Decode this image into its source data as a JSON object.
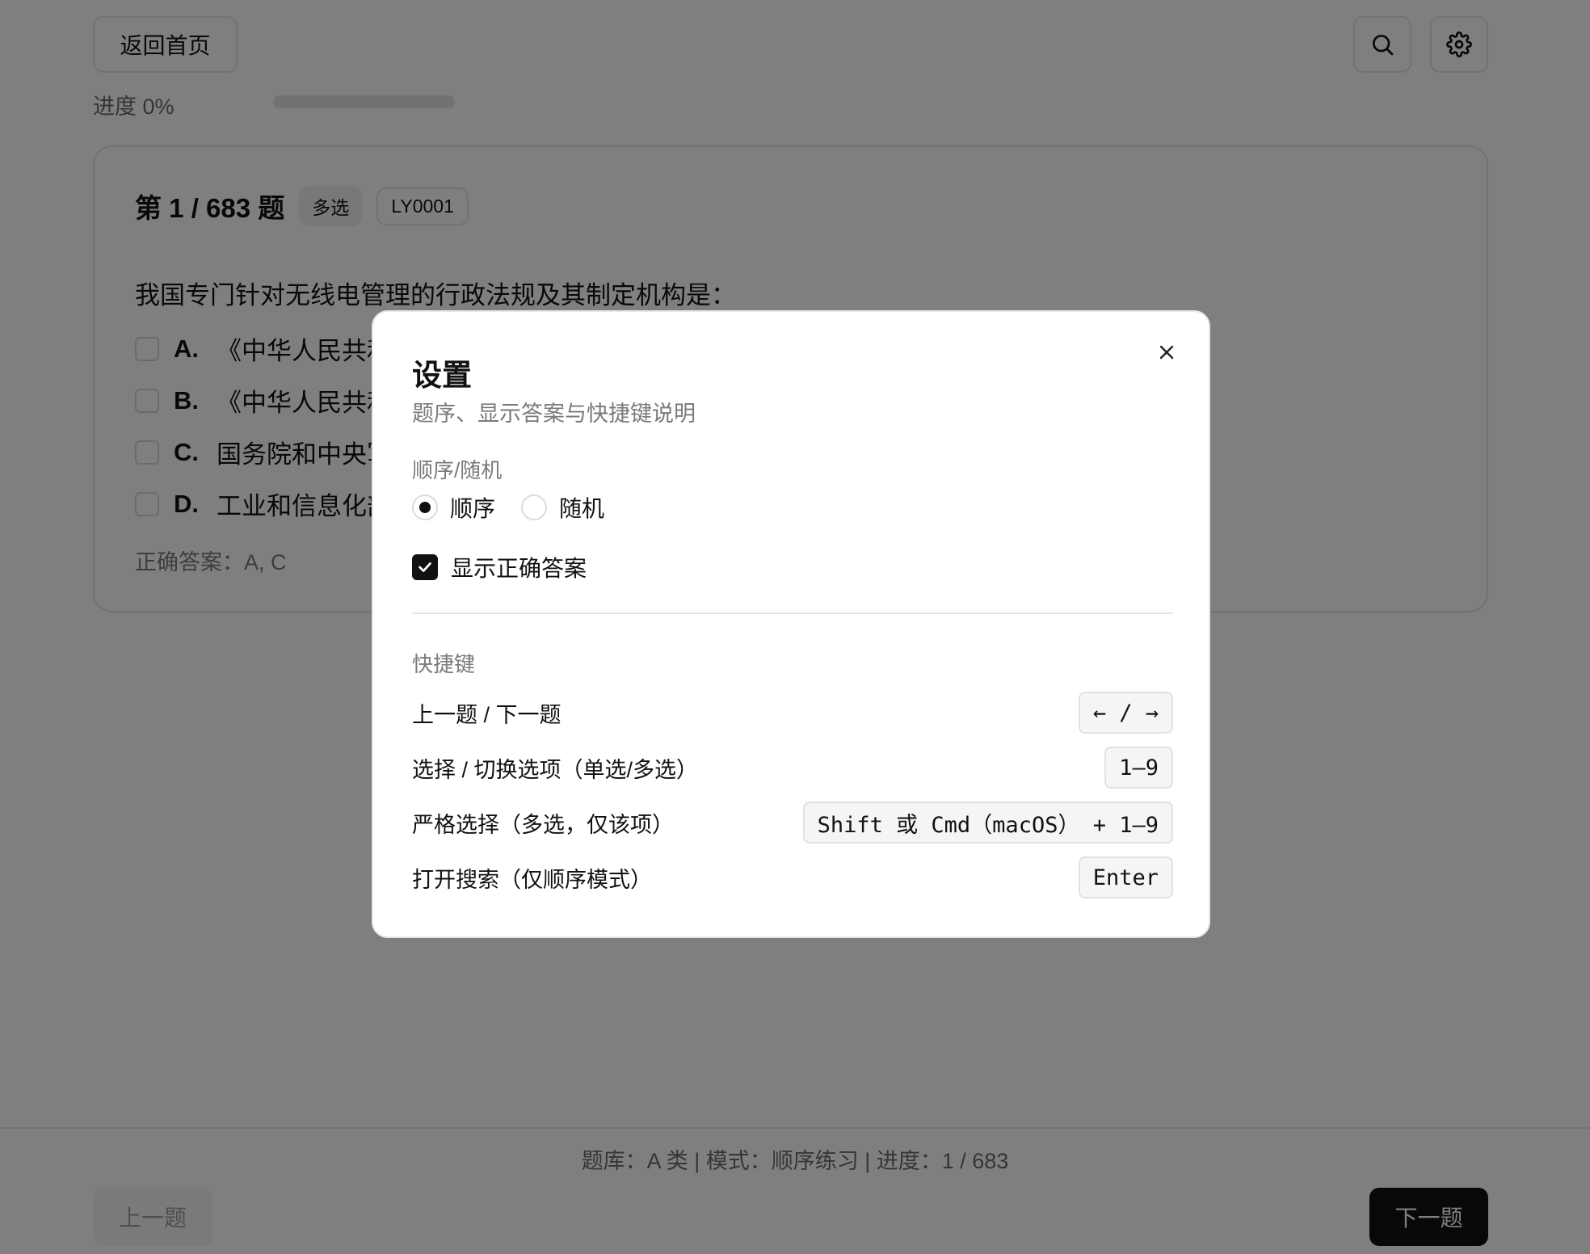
{
  "header": {
    "home_label": "返回首页",
    "search_icon": "search-icon",
    "settings_icon": "gear-icon",
    "progress_label": "进度 0%",
    "progress_value": 0
  },
  "question": {
    "number_label": "第 1 / 683 题",
    "type_tag": "多选",
    "id_tag": "LY0001",
    "text": "我国专门针对无线电管理的行政法规及其制定机构是：",
    "options": [
      {
        "letter": "A.",
        "text": "《中华人民共和"
      },
      {
        "letter": "B.",
        "text": "《中华人民共和"
      },
      {
        "letter": "C.",
        "text": "国务院和中央军"
      },
      {
        "letter": "D.",
        "text": "工业和信息化部"
      }
    ],
    "answer": "正确答案：A, C"
  },
  "footer": {
    "status": "题库：A 类 | 模式：顺序练习 | 进度：1 / 683",
    "prev_label": "上一题",
    "next_label": "下一题"
  },
  "modal": {
    "title": "设置",
    "subtitle": "题序、显示答案与快捷键说明",
    "order_section": "顺序/随机",
    "order_options": [
      "顺序",
      "随机"
    ],
    "order_selected": "顺序",
    "show_answer_label": "显示正确答案",
    "show_answer_checked": true,
    "shortcuts_section": "快捷键",
    "shortcuts": [
      {
        "label": "上一题 / 下一题",
        "keys": "← / →"
      },
      {
        "label": "选择 / 切换选项（单选/多选）",
        "keys": "1–9"
      },
      {
        "label": "严格选择（多选，仅该项）",
        "keys": "Shift 或 Cmd（macOS） + 1–9"
      },
      {
        "label": "打开搜索（仅顺序模式）",
        "keys": "Enter"
      }
    ]
  }
}
